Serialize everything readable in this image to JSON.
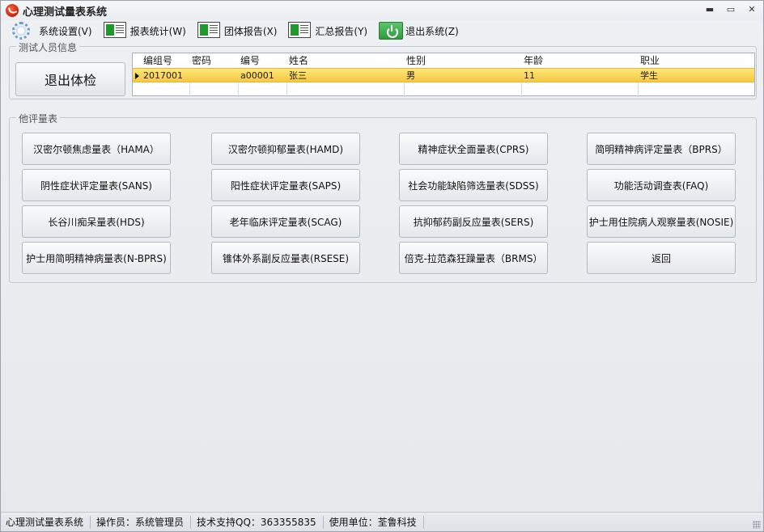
{
  "window": {
    "title": "心理测试量表系统"
  },
  "menu": [
    {
      "label": "系统设置(V)",
      "icon": "gear-icon"
    },
    {
      "label": "报表统计(W)",
      "icon": "report-icon"
    },
    {
      "label": "团体报告(X)",
      "icon": "report-icon"
    },
    {
      "label": "汇总报告(Y)",
      "icon": "report-icon"
    },
    {
      "label": "退出系统(Z)",
      "icon": "power-icon"
    }
  ],
  "person_group": {
    "legend": "测试人员信息",
    "exit_button": "退出体检",
    "columns": [
      "编组号",
      "密码",
      "编号",
      "姓名",
      "性别",
      "年龄",
      "职业"
    ],
    "rows": [
      [
        "2017001",
        "",
        "a00001",
        "张三",
        "男",
        "11",
        "学生"
      ]
    ]
  },
  "scales_group": {
    "legend": "他评量表",
    "buttons": [
      [
        "汉密尔顿焦虑量表（HAMA）",
        "汉密尔顿抑郁量表(HAMD)",
        "精神症状全面量表(CPRS)",
        "简明精神病评定量表（BPRS）"
      ],
      [
        "阴性症状评定量表(SANS)",
        "阳性症状评定量表(SAPS)",
        "社会功能缺陷筛选量表(SDSS)",
        "功能活动调查表(FAQ)"
      ],
      [
        "长谷川痴呆量表(HDS)",
        "老年临床评定量表(SCAG)",
        "抗抑郁药副反应量表(SERS)",
        "护士用住院病人观察量表(NOSIE)"
      ],
      [
        "护士用简明精神病量表(N-BPRS)",
        "锥体外系副反应量表(RSESE)",
        "倍克-拉范森狂躁量表（BRMS）",
        "返回"
      ]
    ]
  },
  "statusbar": {
    "app": "心理测试量表系统",
    "operator": "操作员：系统管理员",
    "support": "技术支持QQ：363355835",
    "unit": "使用单位：荃鲁科技"
  }
}
